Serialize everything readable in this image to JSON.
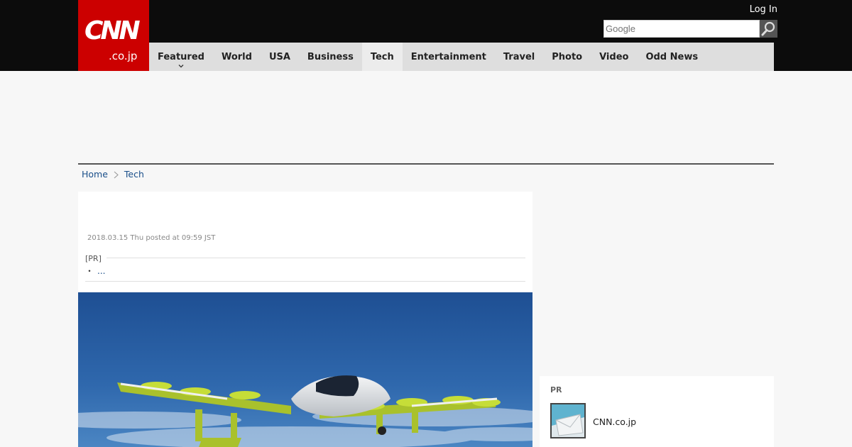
{
  "header": {
    "logo_main": "CNN",
    "logo_sub": ".co.jp",
    "login_label": "Log In",
    "search_placeholder": "Google",
    "search_icon": "magnifier-icon"
  },
  "nav": {
    "items": [
      {
        "label": "Featured"
      },
      {
        "label": "World"
      },
      {
        "label": "USA"
      },
      {
        "label": "Business"
      },
      {
        "label": "Tech"
      },
      {
        "label": "Entertainment"
      },
      {
        "label": "Travel"
      },
      {
        "label": "Photo"
      },
      {
        "label": "Video"
      },
      {
        "label": "Odd News"
      }
    ],
    "active": "Tech"
  },
  "breadcrumb": {
    "home": "Home",
    "section": "Tech"
  },
  "article": {
    "date": "2018.03.15 Thu posted at 09:59 JST",
    "pr_label": "[PR]",
    "pr_bullet": "・",
    "pr_link": "..."
  },
  "sidebar": {
    "pr_label": "PR",
    "item_name": "CNN.co.jp"
  },
  "colors": {
    "brand_red": "#cc0000",
    "topbar": "#0c0c0c",
    "link": "#1a4f8a"
  }
}
